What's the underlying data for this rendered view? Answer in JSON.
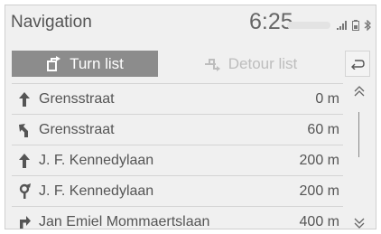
{
  "header": {
    "title": "Navigation",
    "time": "6:25"
  },
  "tabs": {
    "turn_list": "Turn list",
    "detour_list": "Detour list"
  },
  "rows": [
    {
      "icon": "straight-arrow-icon",
      "street": "Grensstraat",
      "distance": "0 m"
    },
    {
      "icon": "slight-left-arrow-icon",
      "street": "Grensstraat",
      "distance": "60 m"
    },
    {
      "icon": "straight-arrow-icon",
      "street": "J. F. Kennedylaan",
      "distance": "200 m"
    },
    {
      "icon": "roundabout-icon",
      "street": "J. F. Kennedylaan",
      "distance": "200 m"
    },
    {
      "icon": "turn-right-arrow-icon",
      "street": "Jan Emiel Mommaertslaan",
      "distance": "400 m"
    }
  ]
}
